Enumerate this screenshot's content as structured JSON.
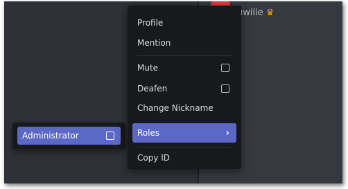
{
  "chat": {
    "username": "uwilie",
    "crown_icon": "crown-icon",
    "avatar_color": "#d83c3e"
  },
  "context_menu": {
    "items": [
      {
        "label": "Profile"
      },
      {
        "label": "Mention"
      },
      {
        "label": "Mute",
        "checkbox": true,
        "checked": false
      },
      {
        "label": "Deafen",
        "checkbox": true,
        "checked": false
      },
      {
        "label": "Change Nickname"
      },
      {
        "label": "Roles",
        "submenu": true,
        "active": true
      },
      {
        "label": "Copy ID"
      }
    ]
  },
  "roles_submenu": {
    "items": [
      {
        "label": "Administrator",
        "checkbox": true,
        "checked": false
      }
    ]
  },
  "colors": {
    "accent": "#5b68c6",
    "menu_bg": "#18191c",
    "chat_bg": "#36393f"
  }
}
